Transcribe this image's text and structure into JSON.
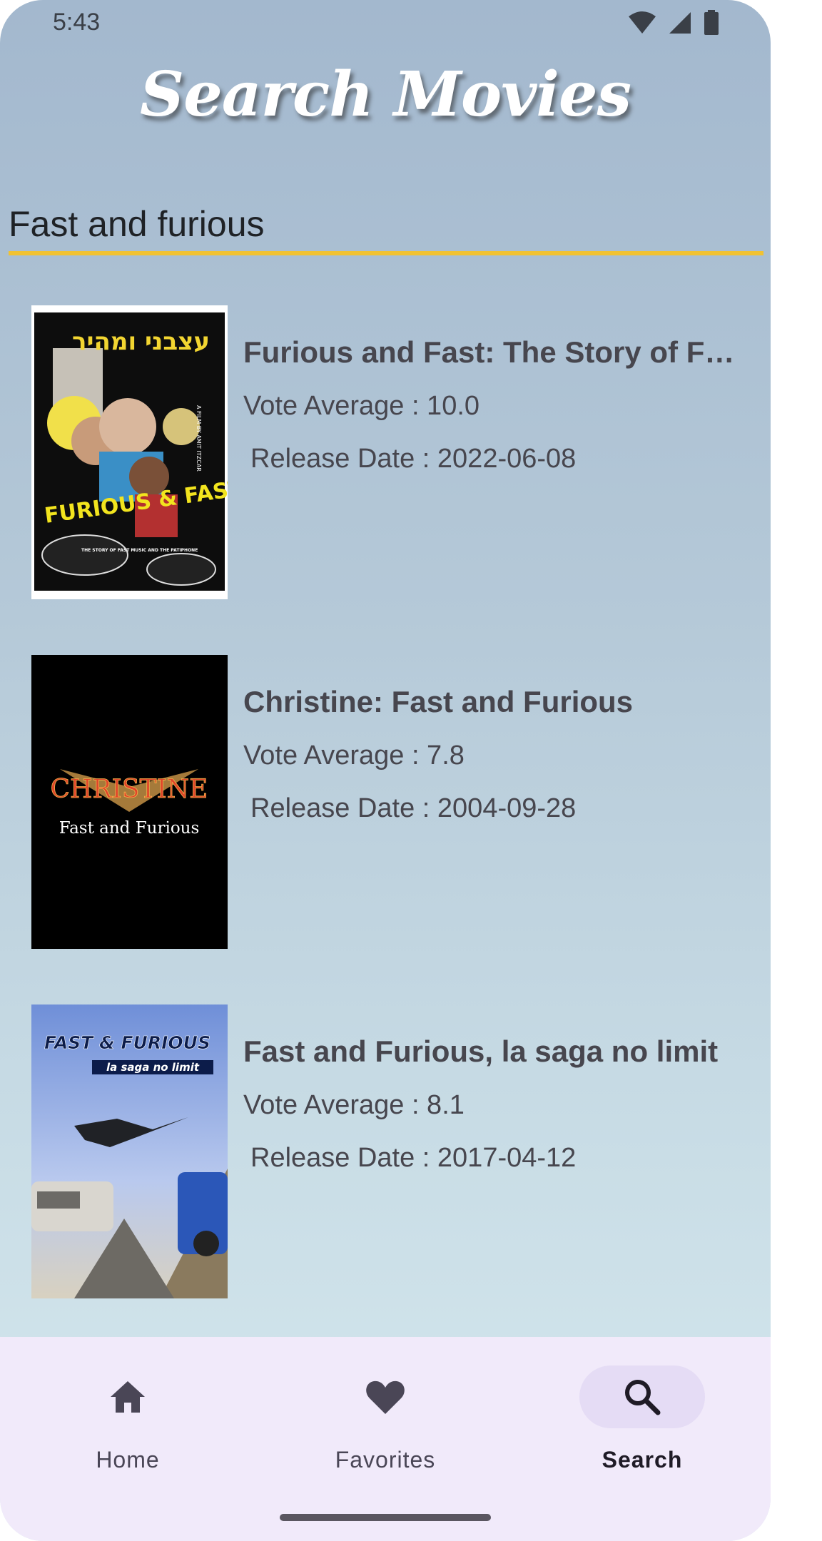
{
  "status_bar": {
    "time": "5:43",
    "icons": [
      "wifi-icon",
      "signal-icon",
      "battery-icon"
    ]
  },
  "header": {
    "title": "Search Movies"
  },
  "search": {
    "value": "Fast and furious",
    "underline_color": "#f1c232"
  },
  "movies": [
    {
      "title": "Furious and Fast: The Story of Fast Music and the Patiphone",
      "vote": "Vote Average : 10.0",
      "release": "Release Date : 2022-06-08",
      "poster": {
        "top_text": "עצבני ומהיר",
        "main_text": "FURIOUS & FAST",
        "sub_text": "THE STORY OF FAST MUSIC AND THE PATIPHONE",
        "side_text": "A FILM BY AMIT ITZCAR"
      }
    },
    {
      "title": "Christine: Fast and Furious",
      "vote": "Vote Average : 7.8",
      "release": "Release Date : 2004-09-28",
      "poster": {
        "main_text": "CHRISTINE",
        "sub_text": "Fast and Furious"
      }
    },
    {
      "title": "Fast and Furious, la saga no limit",
      "vote": "Vote Average : 8.1",
      "release": "Release Date : 2017-04-12",
      "poster": {
        "main_text": "FAST & FURIOUS",
        "sub_text": "la saga no limit"
      }
    }
  ],
  "bottom_nav": {
    "items": [
      {
        "label": "Home",
        "icon": "home-icon",
        "active": false
      },
      {
        "label": "Favorites",
        "icon": "heart-icon",
        "active": false
      },
      {
        "label": "Search",
        "icon": "search-icon",
        "active": true
      }
    ]
  },
  "colors": {
    "accent": "#f1c232",
    "nav_background": "#f1eafa",
    "nav_active_pill": "#e5dcf5",
    "text": "#47464e"
  }
}
